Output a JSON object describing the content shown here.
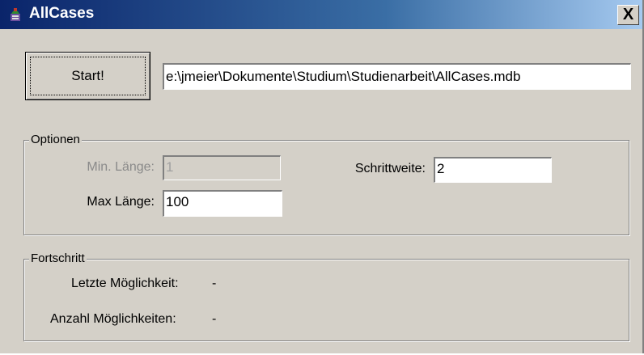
{
  "window": {
    "title": "AllCases",
    "close_label": "X"
  },
  "toolbar": {
    "start_label": "Start!",
    "path_value": "e:\\jmeier\\Dokumente\\Studium\\Studienarbeit\\AllCases.mdb"
  },
  "options": {
    "legend": "Optionen",
    "min_label": "Min. Länge:",
    "min_value": "1",
    "max_label": "Max Länge:",
    "max_value": "100",
    "step_label": "Schrittweite:",
    "step_value": "2"
  },
  "progress": {
    "legend": "Fortschritt",
    "last_label": "Letzte Möglichkeit:",
    "last_value": "-",
    "count_label": "Anzahl Möglichkeiten:",
    "count_value": "-"
  }
}
